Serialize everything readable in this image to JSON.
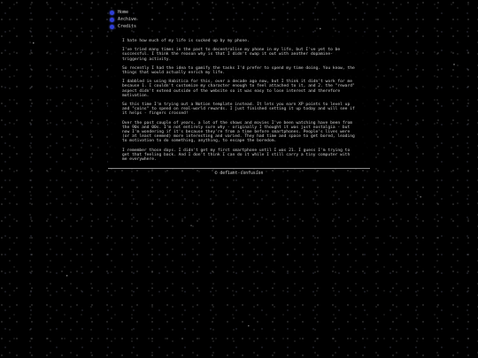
{
  "nav": {
    "items": [
      {
        "label": "Home"
      },
      {
        "label": "Archive"
      },
      {
        "label": "Credits"
      }
    ]
  },
  "post": {
    "paragraphs": [
      "I hate how much of my life is sucked up by my phone.",
      "I've tried many times in the past to decentralise my phone in my life, but I've yet to be successful. I think the reason why is that I didn't swap it out with another dopamine-triggering activity.",
      "So recently I had the idea to gamify the tasks I'd prefer to spend my time doing. You know, the things that would actually enrich my life.",
      "I dabbled in using Habitica for this, over a decade ago now, but I think it didn't work for me because 1. I couldn't customize my character enough to feel attached to it, and 2. the \"reward\" aspect didn't extend outside of the website so it was easy to lose interest and therefore motivation.",
      "So this time I'm trying out a Notion template instead. It lets you earn XP points to level up and \"coins\" to spend on real-world rewards. I just finished setting it up today and will see if it helps - fingers crossed!",
      "Over the past couple of years, a lot of the shows and movies I've been watching have been from the 90s and 00s. I'm not entirely sure why - originally I thought it was just nostalgia - but now I'm wondering if it's because they're from a time before smartphones. People's lives were (or at least seemed) more interesting and varied. They had time and space to get bored, leading to motivation to do something, anything, to escape the boredom.",
      "I remember those days. I didn't get my first smartphone until I was 21. I guess I'm trying to get that feeling back. And I don't think I can do it while I still carry a tiny computer with me everywhere."
    ]
  },
  "footer": {
    "text": "© defiant-confusion"
  },
  "colors": {
    "background": "#000000",
    "text": "#cfcfcf",
    "bullet": "#2f3fd6",
    "divider": "#8a8a8a"
  }
}
